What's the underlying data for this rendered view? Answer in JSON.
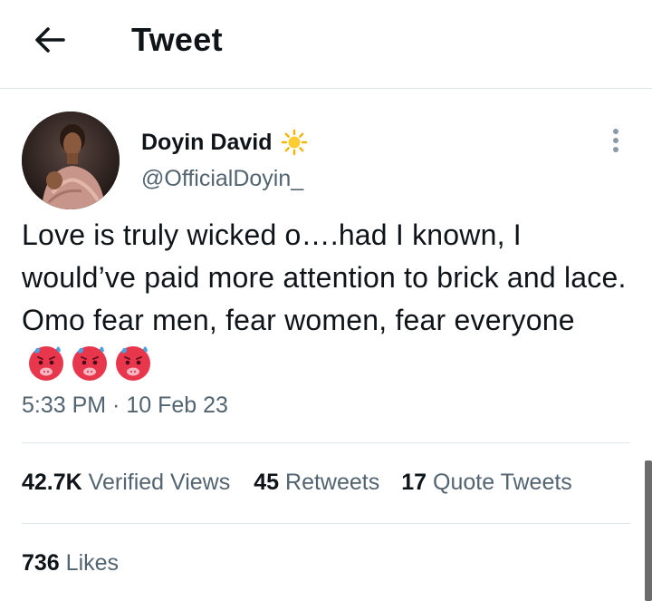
{
  "header": {
    "title": "Tweet",
    "back_icon": "arrow-left-icon"
  },
  "author": {
    "display_name": "Doyin David",
    "name_emoji": "sun-emoji",
    "handle": "@OfficialDoyin_"
  },
  "tweet": {
    "text": "Love is truly wicked o….had I known, I would’ve paid more attention to brick and lace. Omo fear men, fear women, fear everyone",
    "emojis": [
      "anxious-sweat-face-emoji",
      "anxious-sweat-face-emoji",
      "anxious-sweat-face-emoji"
    ],
    "timestamp": "5:33 PM · 10 Feb 23"
  },
  "stats": {
    "views_count": "42.7K",
    "views_label": "Verified Views",
    "retweets_count": "45",
    "retweets_label": "Retweets",
    "quotes_count": "17",
    "quotes_label": "Quote Tweets",
    "likes_count": "736",
    "likes_label": "Likes"
  },
  "colors": {
    "text_primary": "#0f1419",
    "text_secondary": "#536471",
    "divider": "#e1e6ea",
    "emoji_red": "#e8374d",
    "sun": "#f4b400"
  }
}
